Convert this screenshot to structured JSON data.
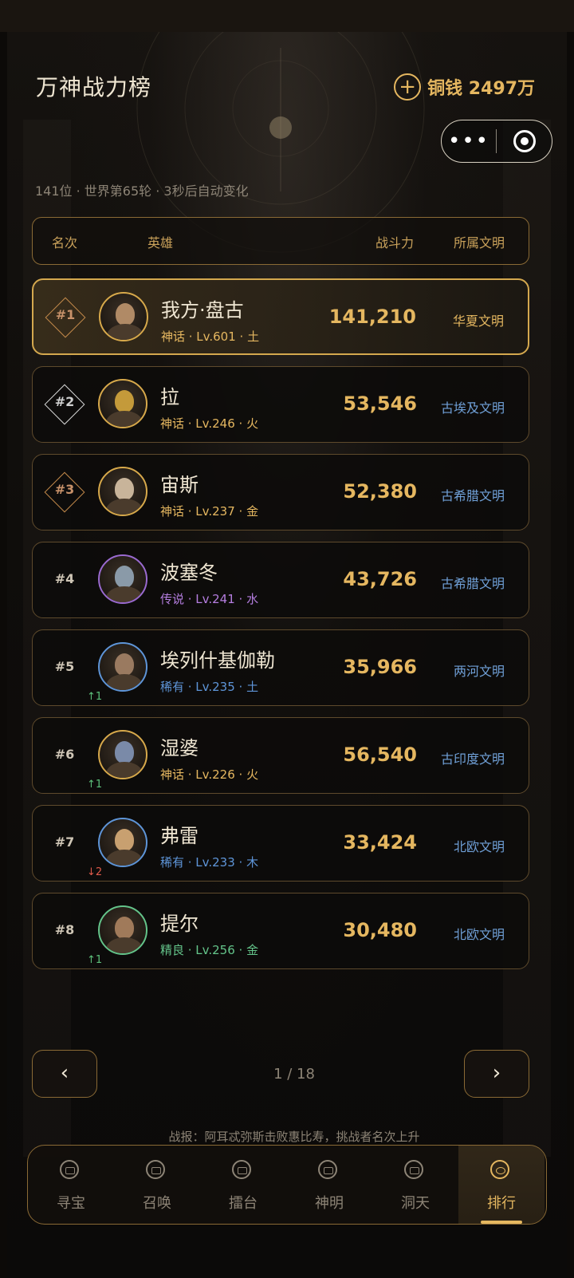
{
  "header": {
    "title": "万神战力榜",
    "coins_label": "铜钱 2497万",
    "subtitle": "141位 · 世界第65轮 · 3秒后自动变化"
  },
  "capsule": {
    "more": "•••"
  },
  "columns": {
    "rank": "名次",
    "hero": "英雄",
    "power": "战斗力",
    "civ": "所属文明"
  },
  "rows": [
    {
      "rank": "#1",
      "name": "我方·盘古",
      "meta": "神话 · Lv.601 · 土",
      "power": "141,210",
      "civ": "华夏文明",
      "trend": ""
    },
    {
      "rank": "#2",
      "name": "拉",
      "meta": "神话 · Lv.246 · 火",
      "power": "53,546",
      "civ": "古埃及文明",
      "trend": ""
    },
    {
      "rank": "#3",
      "name": "宙斯",
      "meta": "神话 · Lv.237 · 金",
      "power": "52,380",
      "civ": "古希腊文明",
      "trend": ""
    },
    {
      "rank": "#4",
      "name": "波塞冬",
      "meta": "传说 · Lv.241 · 水",
      "power": "43,726",
      "civ": "古希腊文明",
      "trend": ""
    },
    {
      "rank": "#5",
      "name": "埃列什基伽勒",
      "meta": "稀有 · Lv.235 · 土",
      "power": "35,966",
      "civ": "两河文明",
      "trend": "↑1"
    },
    {
      "rank": "#6",
      "name": "湿婆",
      "meta": "神话 · Lv.226 · 火",
      "power": "56,540",
      "civ": "古印度文明",
      "trend": "↑1"
    },
    {
      "rank": "#7",
      "name": "弗雷",
      "meta": "稀有 · Lv.233 · 木",
      "power": "33,424",
      "civ": "北欧文明",
      "trend": "↓2"
    },
    {
      "rank": "#8",
      "name": "提尔",
      "meta": "精良 · Lv.256 · 金",
      "power": "30,480",
      "civ": "北欧文明",
      "trend": "↑1"
    }
  ],
  "colors": {
    "mythic": "#e5b760",
    "legend": "#b57ee0",
    "rare": "#5e95d8",
    "fine": "#64c48a",
    "up": "#5cbf7a",
    "down": "#e05a4a"
  },
  "pager": {
    "prev": "‹",
    "next": "›",
    "page": "1 / 18"
  },
  "report": "战报：阿耳忒弥斯击败惠比寿，挑战者名次上升",
  "tabs": [
    {
      "label": "寻宝",
      "icon": "treasure-icon"
    },
    {
      "label": "召唤",
      "icon": "summon-icon"
    },
    {
      "label": "擂台",
      "icon": "arena-icon"
    },
    {
      "label": "神明",
      "icon": "gods-icon"
    },
    {
      "label": "洞天",
      "icon": "cave-icon"
    },
    {
      "label": "排行",
      "icon": "ranking-icon"
    }
  ]
}
